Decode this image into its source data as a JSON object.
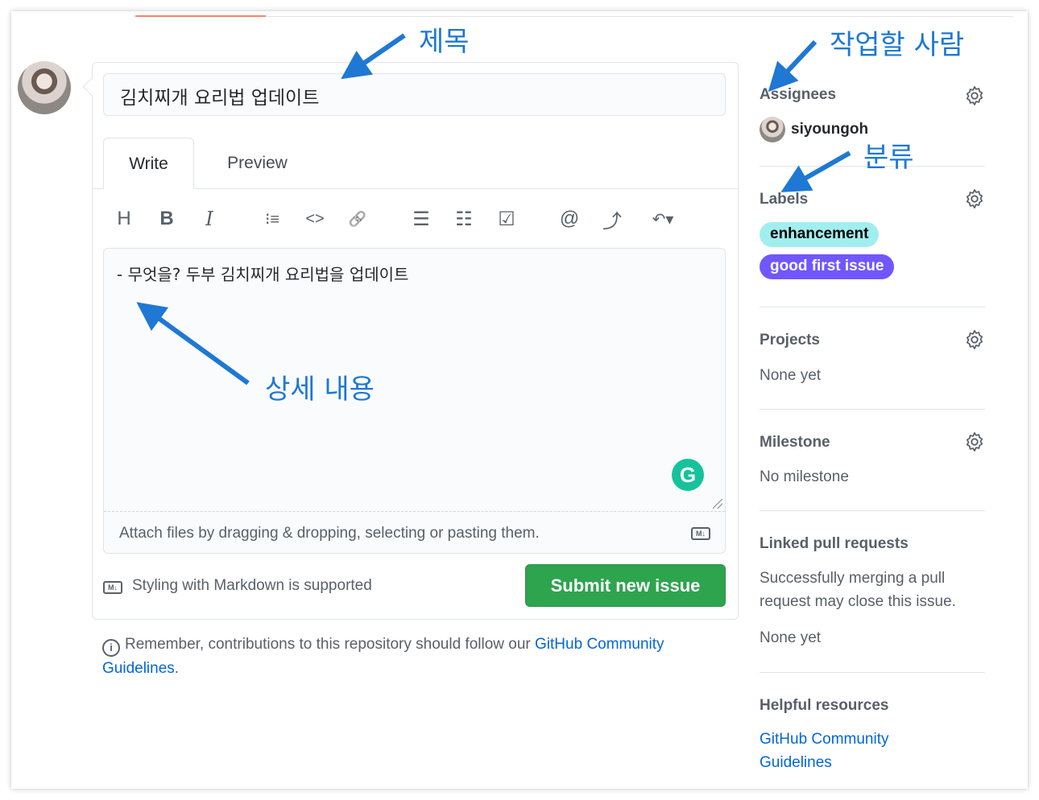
{
  "issue": {
    "title_value": "김치찌개 요리법 업데이트",
    "tabs": [
      {
        "label": "Write"
      },
      {
        "label": "Preview"
      }
    ],
    "toolbar": [
      {
        "icon": "heading-icon",
        "glyph": "H"
      },
      {
        "icon": "bold-icon",
        "glyph": "B"
      },
      {
        "icon": "italic-icon",
        "glyph": "I"
      },
      {
        "icon": "quote-icon",
        "glyph": "⁝≡"
      },
      {
        "icon": "code-icon",
        "glyph": "<>"
      },
      {
        "icon": "link-icon",
        "glyph": "🔗"
      },
      {
        "icon": "bulleted-list-icon",
        "glyph": "☰"
      },
      {
        "icon": "numbered-list-icon",
        "glyph": "☷"
      },
      {
        "icon": "task-list-icon",
        "glyph": "☑"
      },
      {
        "icon": "mention-icon",
        "glyph": "@"
      },
      {
        "icon": "reference-icon",
        "glyph": "⤴"
      },
      {
        "icon": "reply-icon",
        "glyph": "↶▾"
      }
    ],
    "body_value": "- 무엇을? 두부 김치찌개 요리법을 업데이트",
    "attach_text": "Attach files by dragging & dropping, selecting or pasting them.",
    "markdown_badge": "M↓",
    "styling_note": "Styling with Markdown is supported",
    "submit_label": "Submit new issue",
    "remember_text": "Remember, contributions to this repository should follow our",
    "remember_link": "GitHub Community Guidelines",
    "remember_end": "."
  },
  "sidebar": {
    "assignees": {
      "heading": "Assignees",
      "user": "siyoungoh"
    },
    "labels": {
      "heading": "Labels",
      "items": [
        {
          "name": "enhancement",
          "bg": "#a2eeef",
          "fg": "#000000"
        },
        {
          "name": "good first issue",
          "bg": "#7057ff",
          "fg": "#ffffff"
        }
      ]
    },
    "projects": {
      "heading": "Projects",
      "value": "None yet"
    },
    "milestone": {
      "heading": "Milestone",
      "value": "No milestone"
    },
    "linked_prs": {
      "heading": "Linked pull requests",
      "description": "Successfully merging a pull request may close this issue.",
      "value": "None yet"
    },
    "helpful": {
      "heading": "Helpful resources",
      "link": "GitHub Community Guidelines"
    }
  },
  "annotations": {
    "title": "제목",
    "assignee": "작업할 사람",
    "label": "분류",
    "body": "상세 내용"
  },
  "colors": {
    "annotation": "#1e78d4",
    "submit": "#2ea44f",
    "link": "#0366d6"
  }
}
